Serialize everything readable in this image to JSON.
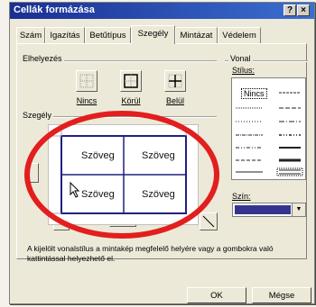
{
  "window": {
    "title": "Cellák formázása",
    "help_label": "?",
    "close_label": "×"
  },
  "tabs": [
    {
      "label": "Szám"
    },
    {
      "label": "Igazítás"
    },
    {
      "label": "Betűtípus"
    },
    {
      "label": "Szegély"
    },
    {
      "label": "Mintázat"
    },
    {
      "label": "Védelem"
    }
  ],
  "active_tab": "Szegély",
  "placement": {
    "label": "Elhelyezés",
    "presets": [
      {
        "label": "Nincs"
      },
      {
        "label": "Körül"
      },
      {
        "label": "Belül"
      }
    ]
  },
  "border": {
    "label": "Szegély"
  },
  "preview": {
    "cells": [
      "Szöveg",
      "Szöveg",
      "Szöveg",
      "Szöveg"
    ]
  },
  "line": {
    "label": "Vonal",
    "style_label": "Stílus:",
    "none_label": "Nincs",
    "color_label": "Szín:",
    "color_value": "#34348f"
  },
  "help_text": "A kijelölt vonalstílus a mintakép megfelelő helyére vagy a gombokra való kattintással helyezhető el.",
  "buttons": {
    "ok": "OK",
    "cancel": "Mégse"
  },
  "annotation": {
    "color": "#e21e1e"
  }
}
